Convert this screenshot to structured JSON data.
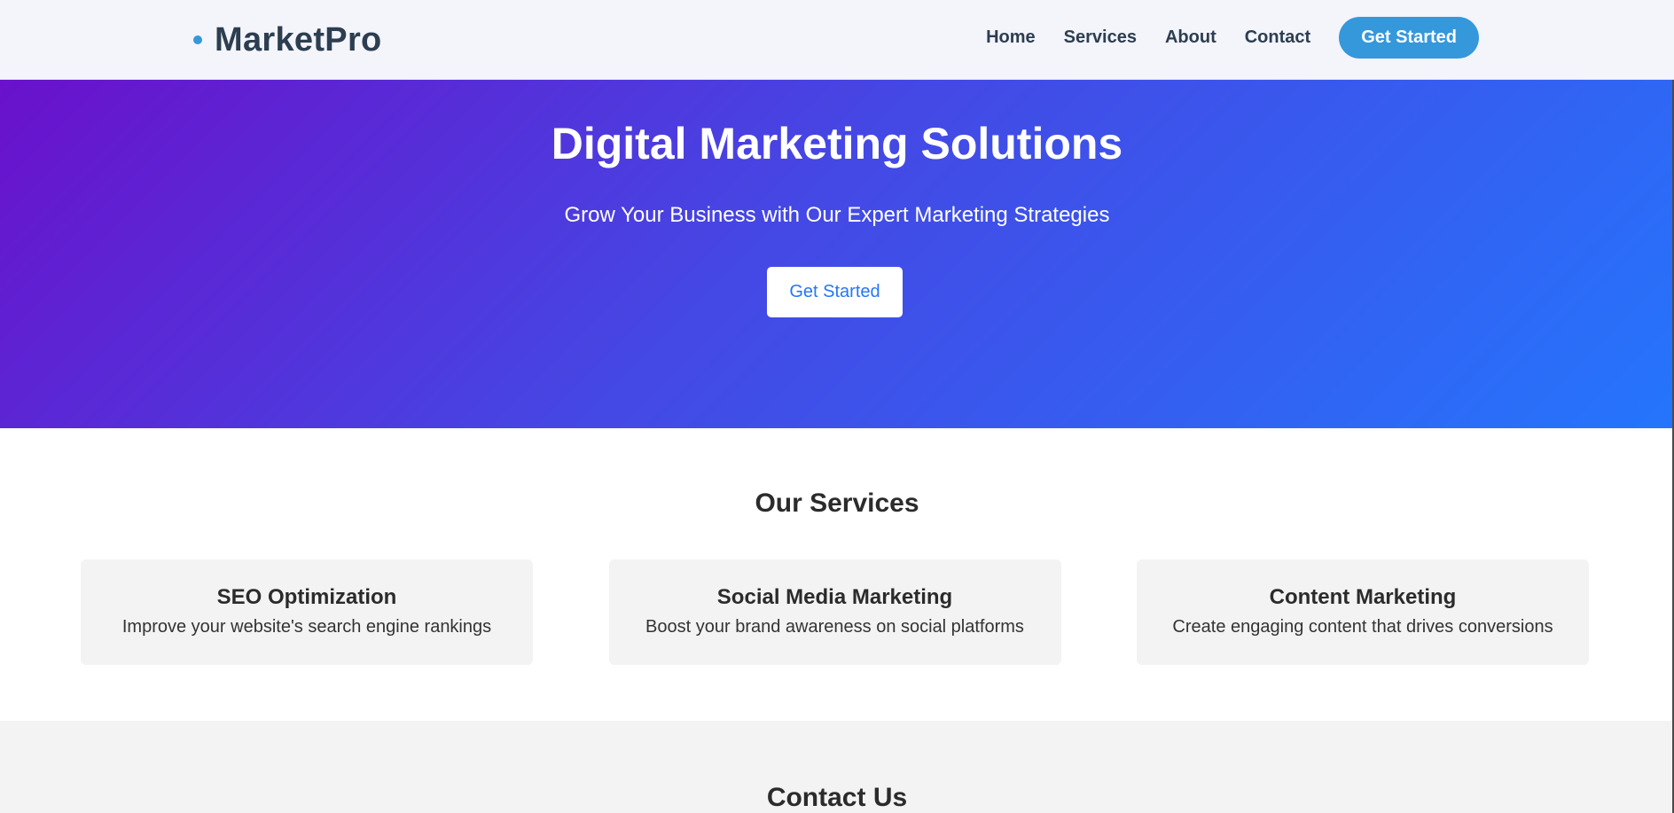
{
  "header": {
    "brand_name": "MarketPro",
    "nav": [
      "Home",
      "Services",
      "About",
      "Contact"
    ],
    "cta_label": "Get Started"
  },
  "hero": {
    "title": "Digital Marketing Solutions",
    "subtitle": "Grow Your Business with Our Expert Marketing Strategies",
    "button_label": "Get Started"
  },
  "services": {
    "title": "Our Services",
    "items": [
      {
        "title": "SEO Optimization",
        "description": "Improve your website's search engine rankings"
      },
      {
        "title": "Social Media Marketing",
        "description": "Boost your brand awareness on social platforms"
      },
      {
        "title": "Content Marketing",
        "description": "Create engaging content that drives conversions"
      }
    ]
  },
  "contact": {
    "title": "Contact Us"
  },
  "colors": {
    "brand": "#2c3e50",
    "accent": "#3498db",
    "hero_gradient_start": "#6a11cb",
    "hero_gradient_end": "#2575fc"
  }
}
